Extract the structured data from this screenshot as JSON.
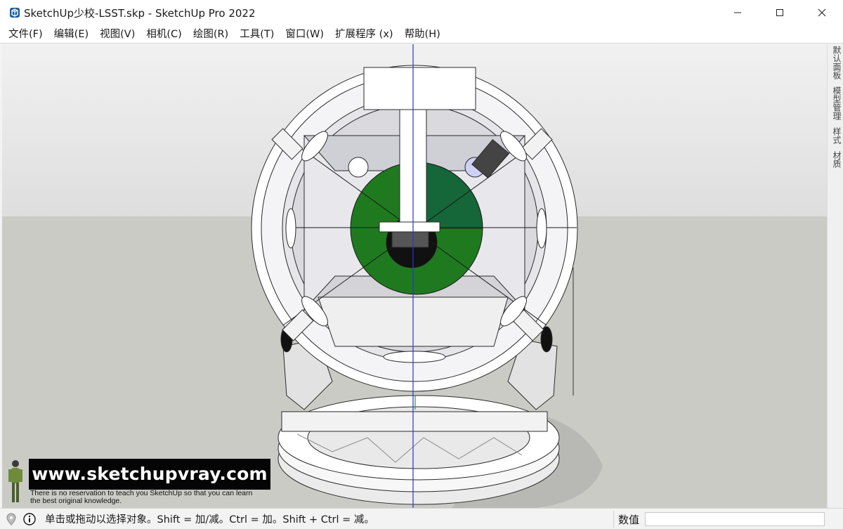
{
  "window": {
    "title": "SketchUp少校-LSST.skp - SketchUp Pro 2022",
    "icon": "sketchup-app-icon"
  },
  "window_controls": [
    "minimize-icon",
    "maximize-icon",
    "close-icon"
  ],
  "menu": [
    {
      "label": "文件(F)"
    },
    {
      "label": "编辑(E)"
    },
    {
      "label": "视图(V)"
    },
    {
      "label": "相机(C)"
    },
    {
      "label": "绘图(R)"
    },
    {
      "label": "工具(T)"
    },
    {
      "label": "窗口(W)"
    },
    {
      "label": "扩展程序 (x)"
    },
    {
      "label": "帮助(H)"
    }
  ],
  "tray": {
    "tabs": [
      {
        "label": "默认面板"
      },
      {
        "label": "模型管理"
      },
      {
        "label": "样式"
      },
      {
        "label": "材质"
      }
    ]
  },
  "watermark": {
    "url": "www.sketchupvray.com",
    "line1": "There is no reservation to teach you SketchUp so that you can learn",
    "line2": " the best original knowledge."
  },
  "status": {
    "hint": "单击或拖动以选择对象。Shift = 加/减。Ctrl = 加。Shift + Ctrl = 减。",
    "measurements_label": "数值",
    "measurements_value": ""
  },
  "colors": {
    "green_axis": "#2a9d2a",
    "blue_axis": "#2b35c9",
    "red_axis": "#d23a3a",
    "mirror_green": "#1f7a1f"
  }
}
